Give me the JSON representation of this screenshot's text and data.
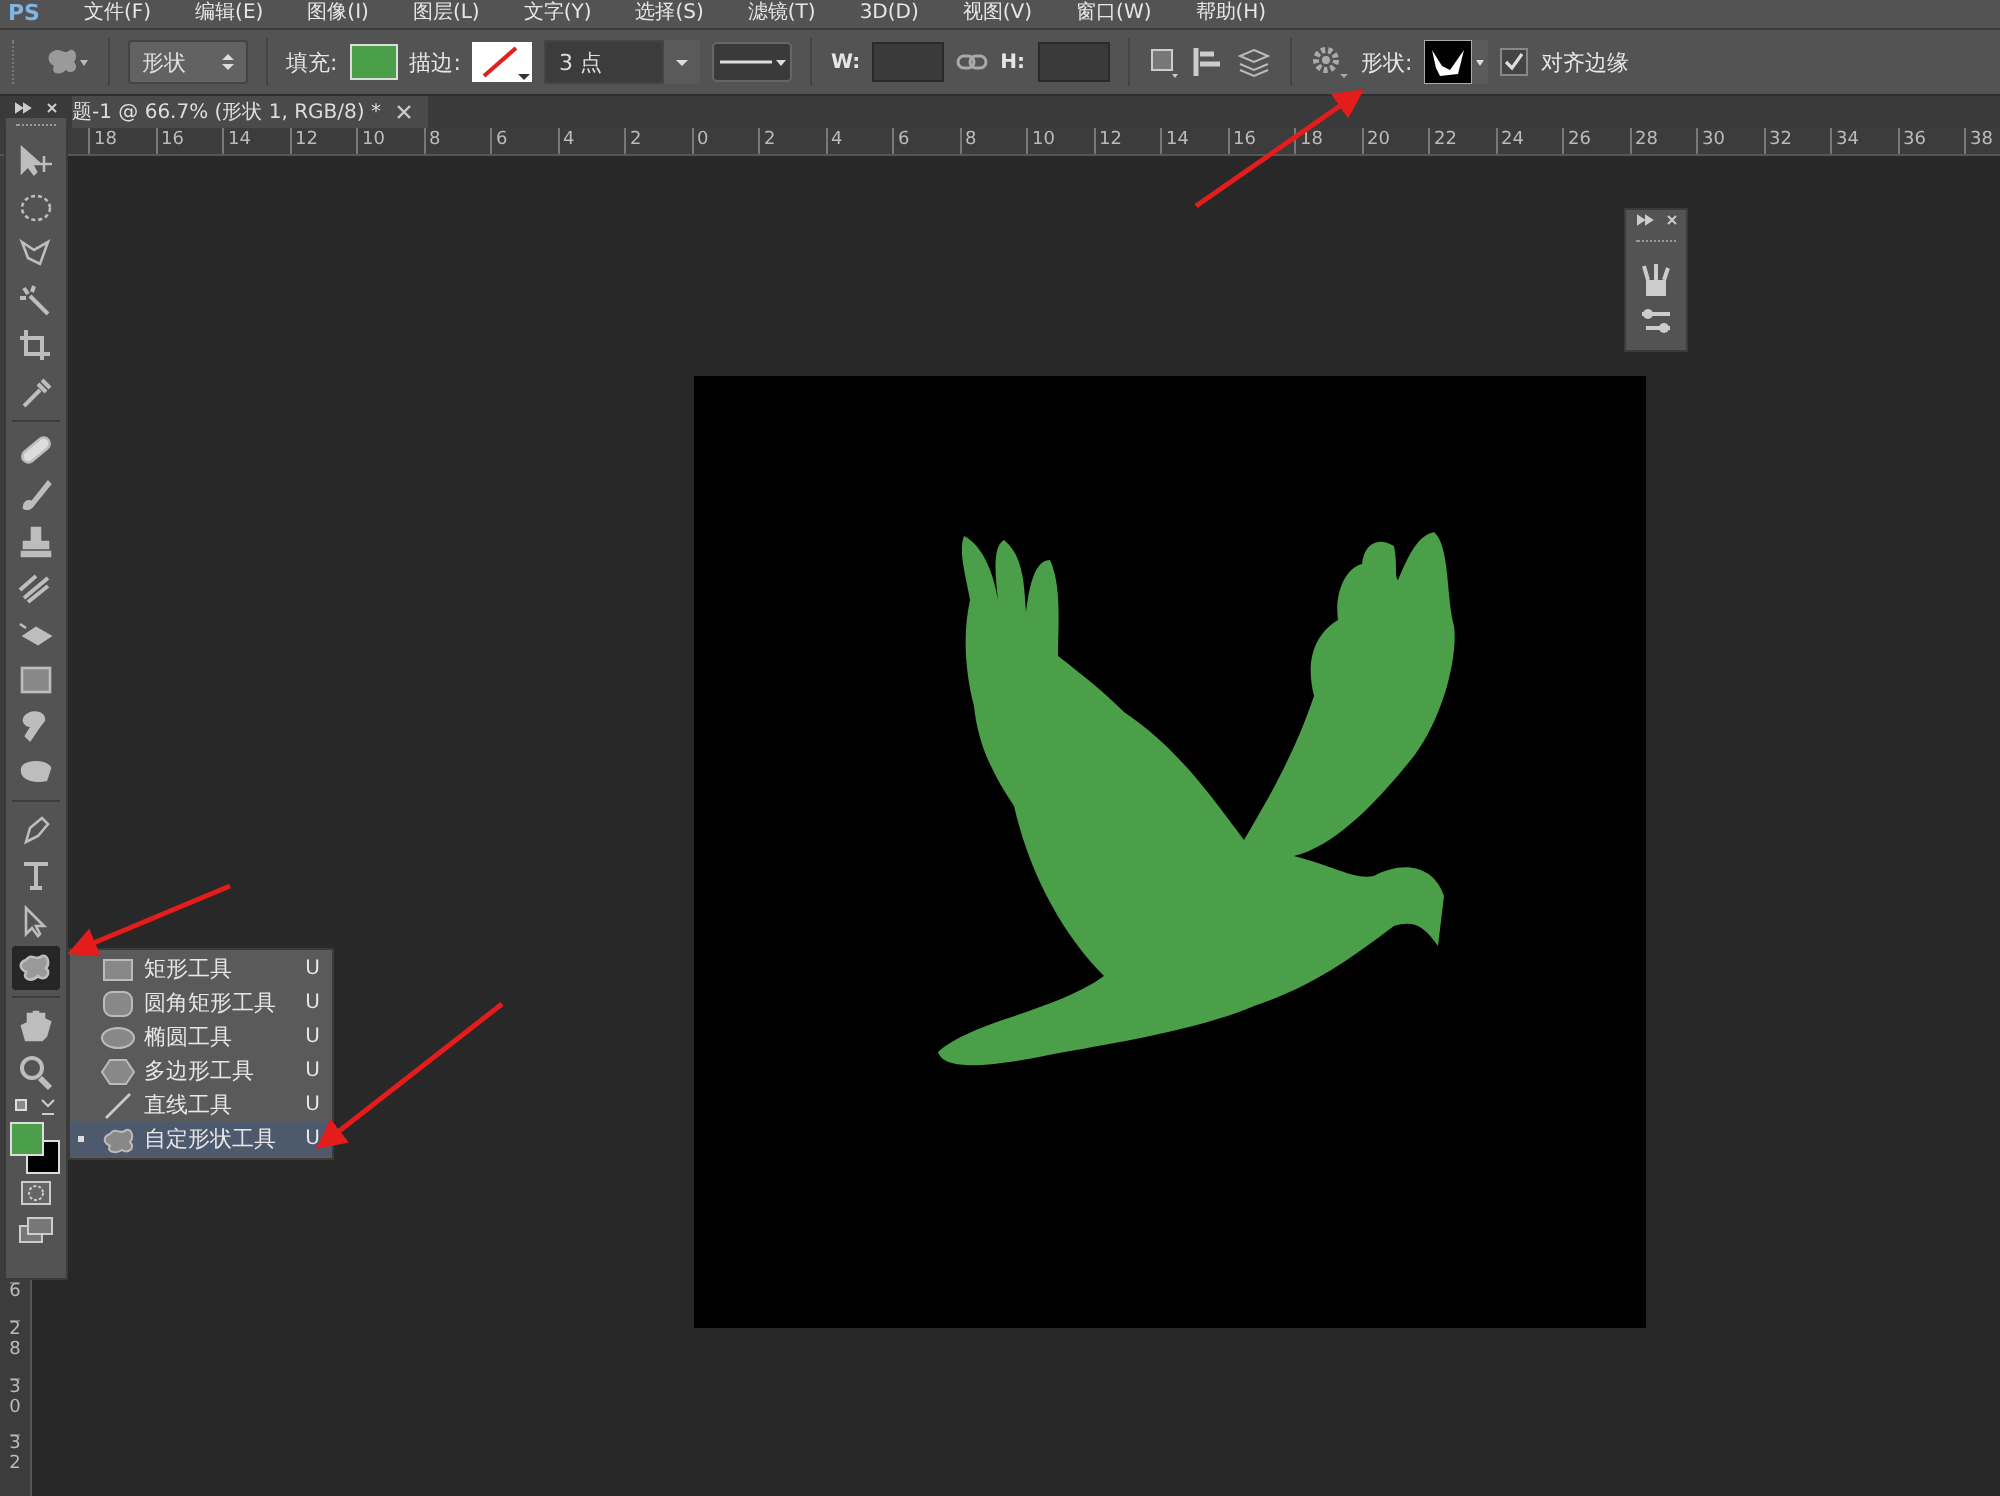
{
  "menu_bar": {
    "logo": "PS",
    "items": [
      "文件(F)",
      "编辑(E)",
      "图像(I)",
      "图层(L)",
      "文字(Y)",
      "选择(S)",
      "滤镜(T)",
      "3D(D)",
      "视图(V)",
      "窗口(W)",
      "帮助(H)"
    ]
  },
  "options_bar": {
    "mode": "形状",
    "fill": {
      "label": "填充:",
      "color": "#4a9f48"
    },
    "stroke": {
      "label": "描边:"
    },
    "stroke_width": "3 点",
    "width_label": "W:",
    "height_label": "H:",
    "shape_label": "形状:",
    "align_edges": {
      "label": "对齐边缘",
      "checked": true
    }
  },
  "document_tab": {
    "title": "题-1 @ 66.7% (形状 1, RGB/8) *"
  },
  "rulers": {
    "horizontal": [
      "18",
      "16",
      "14",
      "12",
      "10",
      "8",
      "6",
      "4",
      "2",
      "0",
      "2",
      "4",
      "6",
      "8",
      "10",
      "12",
      "14",
      "16",
      "18",
      "20",
      "22",
      "24",
      "26",
      "28",
      "30",
      "32",
      "34",
      "36",
      "38"
    ],
    "vertical": [
      "6",
      "28",
      "30",
      "32"
    ]
  },
  "toolbar": {
    "tools": [
      {
        "kind": "move",
        "selected": false,
        "divider_before": false
      },
      {
        "kind": "marquee",
        "selected": false,
        "divider_before": false
      },
      {
        "kind": "lasso",
        "selected": false,
        "divider_before": false
      },
      {
        "kind": "wand",
        "selected": false,
        "divider_before": false
      },
      {
        "kind": "crop",
        "selected": false,
        "divider_before": false
      },
      {
        "kind": "eyedropper",
        "selected": false,
        "divider_before": false
      },
      {
        "kind": "heal",
        "selected": false,
        "divider_before": true
      },
      {
        "kind": "brush",
        "selected": false,
        "divider_before": false
      },
      {
        "kind": "stamp",
        "selected": false,
        "divider_before": false
      },
      {
        "kind": "history",
        "selected": false,
        "divider_before": false
      },
      {
        "kind": "eraser",
        "selected": false,
        "divider_before": false
      },
      {
        "kind": "gradient",
        "selected": false,
        "divider_before": false
      },
      {
        "kind": "blur",
        "selected": false,
        "divider_before": false
      },
      {
        "kind": "dodge",
        "selected": false,
        "divider_before": false
      },
      {
        "kind": "pen",
        "selected": false,
        "divider_before": true
      },
      {
        "kind": "type",
        "selected": false,
        "divider_before": false
      },
      {
        "kind": "select",
        "selected": false,
        "divider_before": false
      },
      {
        "kind": "shape",
        "selected": true,
        "divider_before": false
      },
      {
        "kind": "hand",
        "selected": false,
        "divider_before": true
      },
      {
        "kind": "zoom",
        "selected": false,
        "divider_before": false
      }
    ],
    "color_swatches": [
      {
        "kind": "foreground",
        "color": "#4a9f48"
      },
      {
        "kind": "background",
        "color": "#000000"
      }
    ]
  },
  "tool_flyout": [
    {
      "kind": "rectangle",
      "label": "矩形工具",
      "shortcut": "U",
      "selected": false
    },
    {
      "kind": "rounded",
      "label": "圆角矩形工具",
      "shortcut": "U",
      "selected": false
    },
    {
      "kind": "ellipse",
      "label": "椭圆工具",
      "shortcut": "U",
      "selected": false
    },
    {
      "kind": "polygon",
      "label": "多边形工具",
      "shortcut": "U",
      "selected": false
    },
    {
      "kind": "line",
      "label": "直线工具",
      "shortcut": "U",
      "selected": false
    },
    {
      "kind": "custom",
      "label": "自定形状工具",
      "shortcut": "U",
      "selected": true
    }
  ],
  "canvas": {
    "shape": {
      "color": "#4a9f48"
    }
  }
}
